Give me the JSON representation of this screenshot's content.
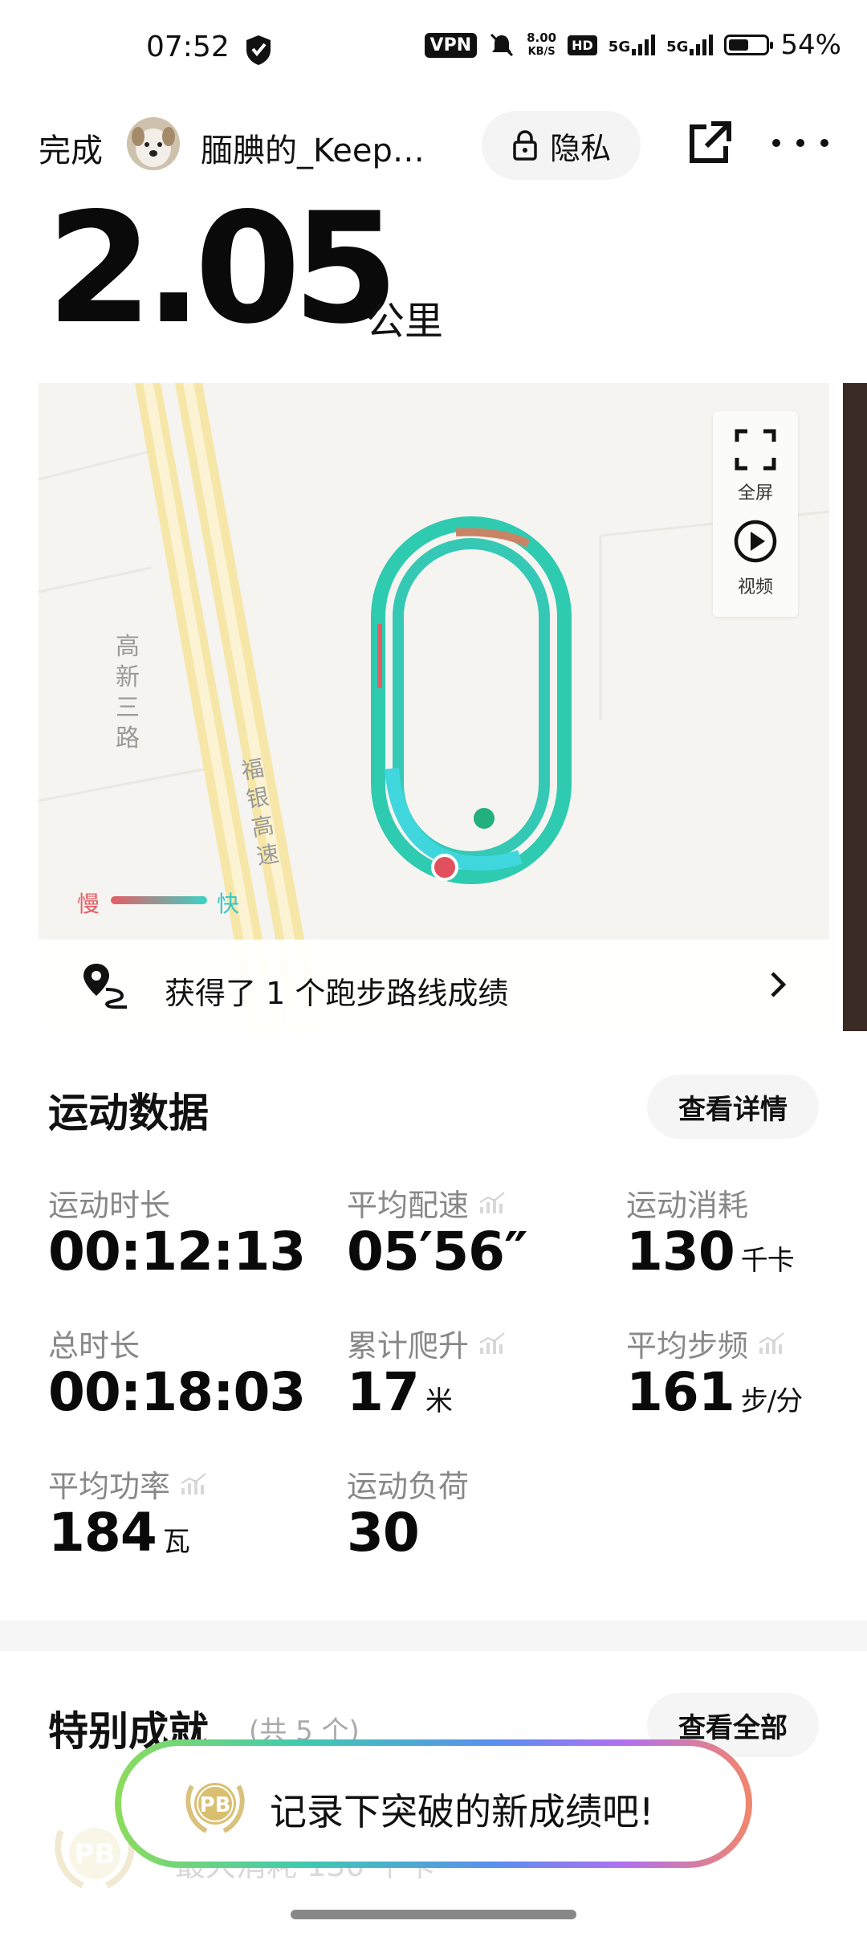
{
  "status_bar": {
    "time": "07:52",
    "vpn": "VPN",
    "net_speed_value": "8.00",
    "net_speed_unit": "KB/S",
    "hd": "HD",
    "signal_1": "5G",
    "signal_2": "5G",
    "battery_percent": "54%",
    "battery_level": 0.54
  },
  "header": {
    "done_label": "完成",
    "username": "腼腆的_Keepe...",
    "privacy_label": "隐私"
  },
  "distance": {
    "value": "2.05",
    "unit": "公里"
  },
  "map": {
    "road_label_1": "高新三路",
    "road_label_2": "福银高速",
    "fullscreen_label": "全屏",
    "video_label": "视频",
    "legend_slow": "慢",
    "legend_fast": "快",
    "route_achievement_text": "获得了 1 个跑步路线成绩",
    "colors": {
      "route_fast": "#2ecbb8",
      "route_slow": "#e45e66",
      "road": "#f6e6a7"
    }
  },
  "sports_data": {
    "title": "运动数据",
    "details_button": "查看详情",
    "stats": [
      {
        "label": "运动时长",
        "value": "00:12:13",
        "unit": "",
        "trend": false
      },
      {
        "label": "平均配速",
        "value": "05′56″",
        "unit": "",
        "trend": true
      },
      {
        "label": "运动消耗",
        "value": "130",
        "unit": "千卡",
        "trend": false
      },
      {
        "label": "总时长",
        "value": "00:18:03",
        "unit": "",
        "trend": false
      },
      {
        "label": "累计爬升",
        "value": "17",
        "unit": "米",
        "trend": true
      },
      {
        "label": "平均步频",
        "value": "161",
        "unit": "步/分",
        "trend": true
      },
      {
        "label": "平均功率",
        "value": "184",
        "unit": "瓦",
        "trend": true
      },
      {
        "label": "运动负荷",
        "value": "30",
        "unit": "",
        "trend": false
      }
    ]
  },
  "achievements": {
    "title": "特别成就",
    "count": "(共 5 个)",
    "view_all_button": "查看全部",
    "faded_item": "最大消耗 130 千卡",
    "badge_text": "PB"
  },
  "toast": {
    "badge_text": "PB",
    "text": "记录下突破的新成绩吧!"
  }
}
